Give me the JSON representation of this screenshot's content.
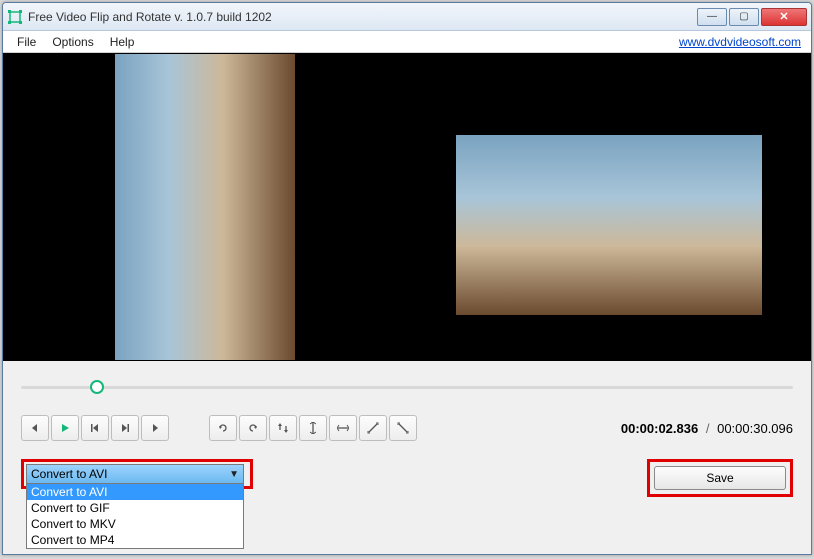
{
  "window": {
    "title": "Free Video Flip and Rotate v. 1.0.7 build 1202"
  },
  "menu": {
    "file": "File",
    "options": "Options",
    "help": "Help",
    "link": "www.dvdvideosoft.com"
  },
  "time": {
    "current": "00:00:02.836",
    "sep": "/",
    "total": "00:00:30.096"
  },
  "format": {
    "selected": "Convert to AVI",
    "options": [
      "Convert to AVI",
      "Convert to GIF",
      "Convert to MKV",
      "Convert to MP4"
    ]
  },
  "buttons": {
    "save": "Save"
  }
}
